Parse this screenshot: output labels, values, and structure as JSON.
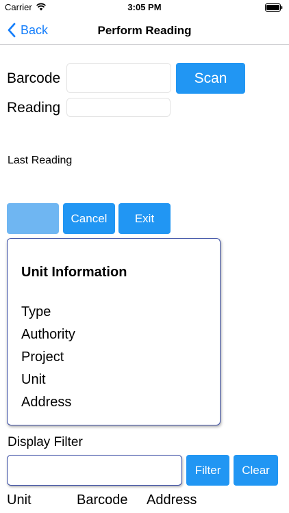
{
  "status_bar": {
    "carrier": "Carrier",
    "time": "3:05 PM"
  },
  "nav": {
    "back_label": "Back",
    "title": "Perform Reading"
  },
  "form": {
    "barcode_label": "Barcode",
    "barcode_value": "",
    "scan_label": "Scan",
    "reading_label": "Reading",
    "reading_value": "",
    "last_reading_label": "Last Reading"
  },
  "actions": {
    "save_label": "",
    "cancel_label": "Cancel",
    "exit_label": "Exit"
  },
  "unit_info": {
    "title": "Unit Information",
    "rows": [
      "Type",
      "Authority",
      "Project",
      "Unit",
      "Address"
    ]
  },
  "filter": {
    "label": "Display Filter",
    "value": "",
    "filter_label": "Filter",
    "clear_label": "Clear"
  },
  "table": {
    "columns": [
      "Unit",
      "Barcode",
      "Address"
    ]
  },
  "colors": {
    "accent": "#2196f3",
    "nav_accent": "#147efb",
    "card_border": "#3b4ea5"
  }
}
